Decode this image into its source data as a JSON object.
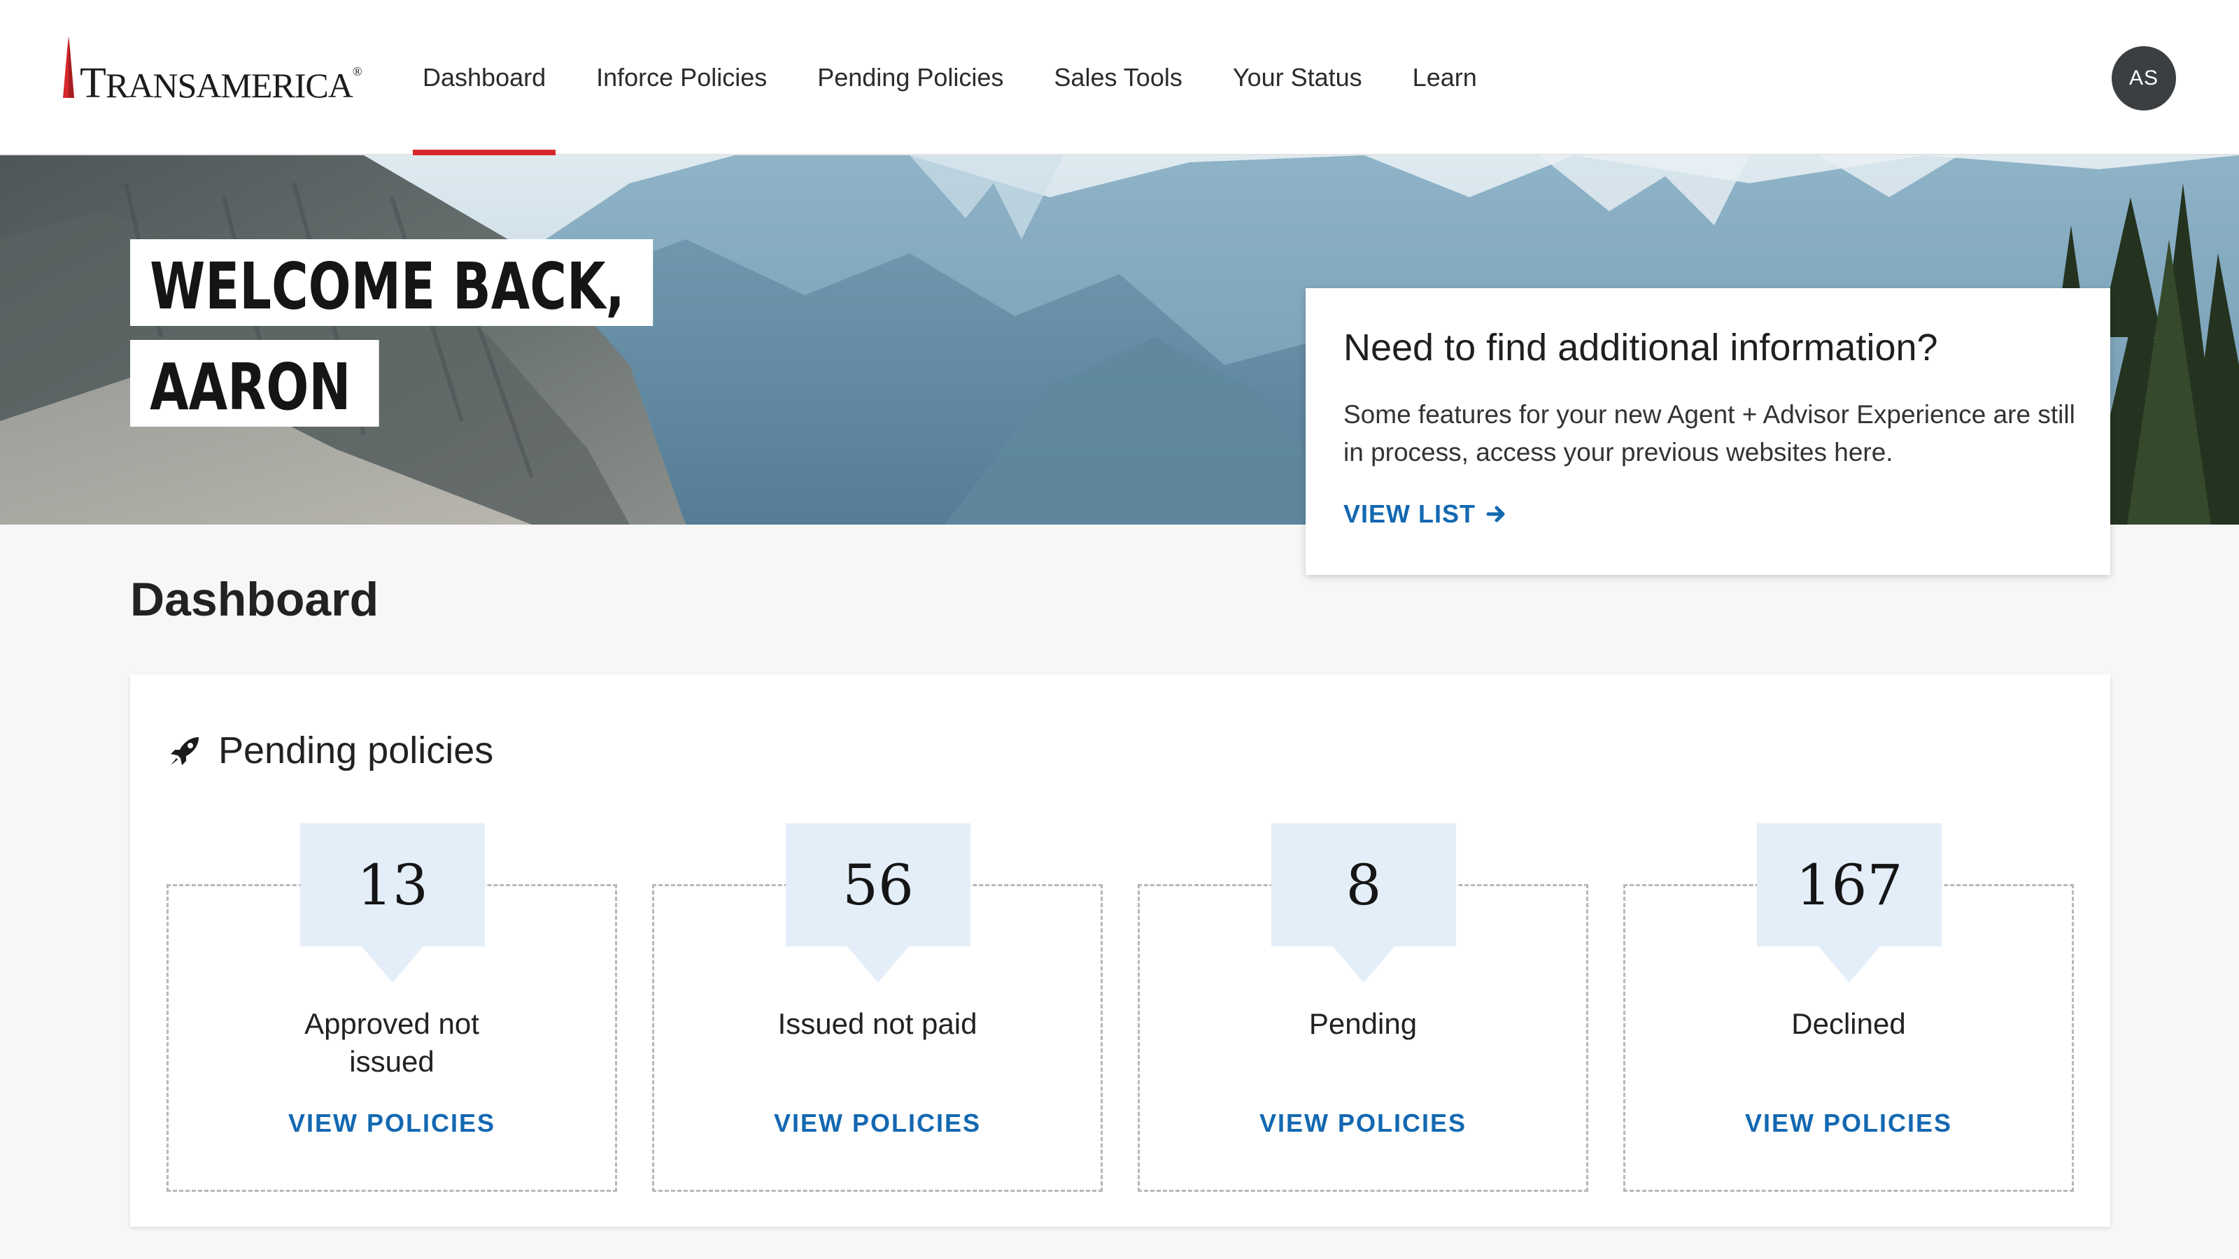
{
  "header": {
    "logo_text_first": "T",
    "logo_text_rest": "RANSAMERICA",
    "logo_mark": "®",
    "nav": [
      {
        "label": "Dashboard",
        "active": true
      },
      {
        "label": "Inforce Policies",
        "active": false
      },
      {
        "label": "Pending Policies",
        "active": false
      },
      {
        "label": "Sales Tools",
        "active": false
      },
      {
        "label": "Your Status",
        "active": false
      },
      {
        "label": "Learn",
        "active": false
      }
    ],
    "avatar_initials": "AS",
    "active_color": "#d6282c"
  },
  "hero": {
    "welcome_line1": "WELCOME BACK,",
    "welcome_line2": "AARON"
  },
  "info_card": {
    "title": "Need to find additional information?",
    "body": "Some features for your new Agent + Advisor Experience are still in process, access your previous websites here.",
    "link_label": "VIEW LIST",
    "link_icon": "arrow-right-icon"
  },
  "dashboard": {
    "title": "Dashboard",
    "pending": {
      "title": "Pending policies",
      "icon": "rocket-icon",
      "stats": [
        {
          "count": "13",
          "label": "Approved not issued",
          "link": "VIEW POLICIES"
        },
        {
          "count": "56",
          "label": "Issued not paid",
          "link": "VIEW POLICIES"
        },
        {
          "count": "8",
          "label": "Pending",
          "link": "VIEW POLICIES"
        },
        {
          "count": "167",
          "label": "Declined",
          "link": "VIEW POLICIES"
        }
      ]
    }
  },
  "colors": {
    "link": "#1368b1",
    "badge_bg": "#e3eef9",
    "avatar_bg": "#3c3f41"
  }
}
